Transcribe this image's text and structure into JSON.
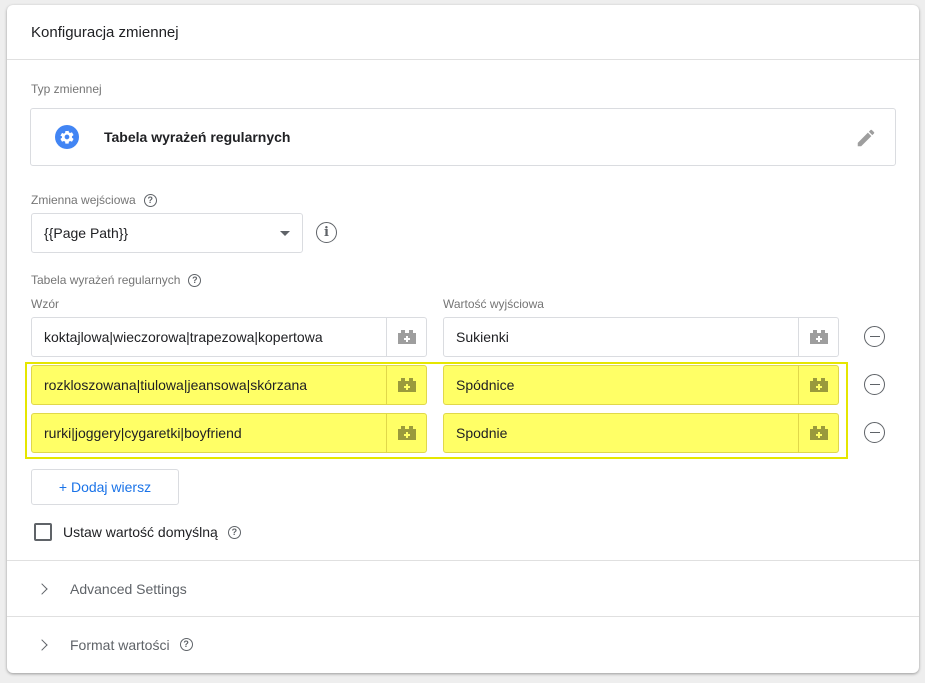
{
  "header": {
    "title": "Konfiguracja zmiennej"
  },
  "variable_type": {
    "label": "Typ zmiennej",
    "name": "Tabela wyrażeń regularnych",
    "icon": "gear-icon",
    "edit_icon": "pencil-icon",
    "icon_color": "#4285f4"
  },
  "input_variable": {
    "label": "Zmienna wejściowa",
    "value": "{{Page Path}}"
  },
  "regex_table": {
    "label": "Tabela wyrażeń regularnych",
    "pattern_header": "Wzór",
    "output_header": "Wartość wyjściowa",
    "rows": [
      {
        "pattern": "koktajlowa|wieczorowa|trapezowa|kopertowa",
        "output": "Sukienki",
        "highlighted": false
      },
      {
        "pattern": "rozkloszowana|tiulowa|jeansowa|skórzana",
        "output": "Spódnice",
        "highlighted": true
      },
      {
        "pattern": "rurki|joggery|cygaretki|boyfriend",
        "output": "Spodnie",
        "highlighted": true
      }
    ],
    "add_row_label": "+ Dodaj wiersz",
    "highlight_color": "#ffff66"
  },
  "default_value": {
    "label": "Ustaw wartość domyślną",
    "checked": false
  },
  "advanced_settings": {
    "label": "Advanced Settings"
  },
  "format_value": {
    "label": "Format wartości"
  },
  "colors": {
    "accent": "#1a73e8",
    "highlight_border": "#e5e600"
  }
}
